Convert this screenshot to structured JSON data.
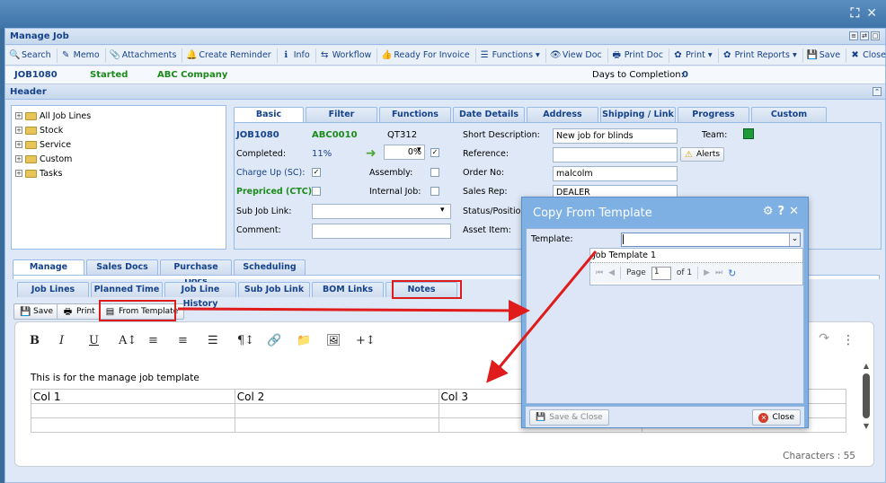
{
  "window_title": "Manage Job",
  "top_icons": [
    "⛶",
    "✕"
  ],
  "toolbar": [
    {
      "icon": "search-icon",
      "glyph": "🔍",
      "label": "Search"
    },
    {
      "icon": "memo-icon",
      "glyph": "✎",
      "label": "Memo"
    },
    {
      "icon": "attachment-icon",
      "glyph": "📎",
      "label": "Attachments"
    },
    {
      "icon": "bell-icon",
      "glyph": "🔔",
      "label": "Create Reminder"
    },
    {
      "icon": "info-icon",
      "glyph": "ℹ",
      "label": "Info"
    },
    {
      "icon": "workflow-icon",
      "glyph": "⇆",
      "label": "Workflow"
    },
    {
      "icon": "thumbs-up-icon",
      "glyph": "👍",
      "label": "Ready For Invoice"
    },
    {
      "icon": "functions-icon",
      "glyph": "☰",
      "label": "Functions ▾"
    },
    {
      "icon": "view-icon",
      "glyph": "👁",
      "label": "View Doc"
    },
    {
      "icon": "print-doc-icon",
      "glyph": "🖶",
      "label": "Print Doc"
    },
    {
      "icon": "print-icon",
      "glyph": "✿",
      "label": "Print ▾"
    },
    {
      "icon": "reports-icon",
      "glyph": "✿",
      "label": "Print Reports ▾"
    },
    {
      "icon": "save-icon",
      "glyph": "💾",
      "label": "Save"
    },
    {
      "icon": "close-icon",
      "glyph": "✖",
      "label": "Close"
    }
  ],
  "job": {
    "number": "JOB1080",
    "status": "Started",
    "company": "ABC Company",
    "days_label": "Days to Completion:",
    "days_value": "0"
  },
  "header_title": "Header",
  "tree": [
    "All Job Lines",
    "Stock",
    "Service",
    "Custom",
    "Tasks"
  ],
  "basic_tabs": [
    "Basic",
    "Filter",
    "Functions",
    "Date Details",
    "Address",
    "Shipping / Link",
    "Progress",
    "Custom"
  ],
  "basic": {
    "job": "JOB1080",
    "code": "ABC0010",
    "quote": "QT312",
    "completed_label": "Completed:",
    "completed_value": "11%",
    "completed_pct": "0%",
    "charge_up_label": "Charge Up (SC):",
    "assembly_label": "Assembly:",
    "prepriced_label": "Prepriced (CTC):",
    "internal_label": "Internal Job:",
    "sub_job_label": "Sub Job Link:",
    "comment_label": "Comment:",
    "short_desc_label": "Short Description:",
    "short_desc_value": "New job for blinds",
    "reference_label": "Reference:",
    "reference_value": "",
    "order_label": "Order No:",
    "order_value": "malcolm",
    "sales_rep_label": "Sales Rep:",
    "sales_rep_value": "DEALER",
    "status_label": "Status/Position:",
    "asset_label": "Asset Item:",
    "team_label": "Team:",
    "team_color": "#1f9a3a",
    "alerts_label": "Alerts"
  },
  "manage_tabs": [
    "Manage",
    "Sales Docs",
    "Purchase Docs",
    "Scheduling"
  ],
  "sub_tabs": [
    "Job Lines",
    "Planned Time",
    "Job Line History",
    "Sub Job Link",
    "BOM Links",
    "Notes"
  ],
  "notes_toolbar": {
    "save": "Save",
    "print": "Print",
    "from_template": "From Template"
  },
  "editor": {
    "buttons": [
      "B",
      "I",
      "U",
      "A↕",
      "≡",
      "≡",
      "☰",
      "¶↕",
      "🔗",
      "📁",
      "🖼",
      "+↕"
    ],
    "text": "This is for the manage job template",
    "columns": [
      "Col 1",
      "Col 2",
      "Col 3",
      ""
    ],
    "characters": "Characters : 55"
  },
  "dialog": {
    "title": "Copy From Template",
    "template_label": "Template:",
    "template_value": "",
    "option": "Job Template 1",
    "page_label": "Page",
    "page_value": "1",
    "of_label": "of 1",
    "save_close": "Save & Close",
    "close": "Close"
  },
  "accent": "#e01b1b"
}
